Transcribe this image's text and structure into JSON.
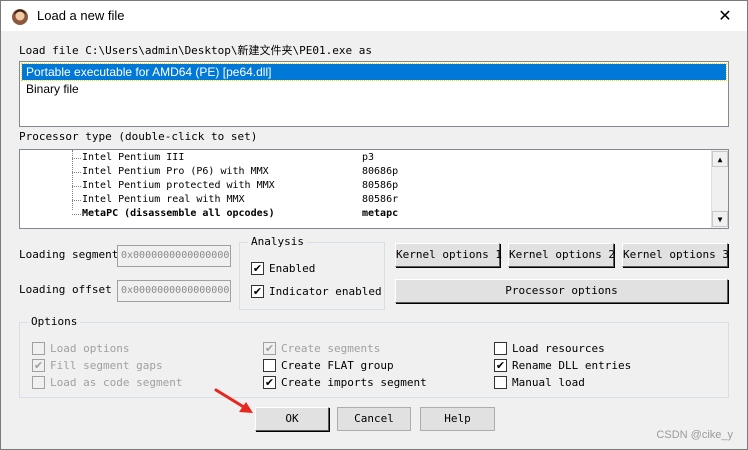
{
  "window": {
    "title": "Load a new file",
    "close_glyph": "✕",
    "icon": "app-avatar-icon"
  },
  "load_file": {
    "label": "Load file C:\\Users\\admin\\Desktop\\新建文件夹\\PE01.exe as",
    "formats": [
      {
        "label": "Portable executable for AMD64 (PE) [pe64.dll]",
        "selected": true
      },
      {
        "label": "Binary file",
        "selected": false
      }
    ]
  },
  "processor": {
    "label": "Processor type (double-click to set)",
    "items": [
      {
        "name": "Intel Pentium III",
        "code": "p3"
      },
      {
        "name": "Intel Pentium Pro (P6) with MMX",
        "code": "80686p"
      },
      {
        "name": "Intel Pentium protected with MMX",
        "code": "80586p"
      },
      {
        "name": "Intel Pentium real with MMX",
        "code": "80586r"
      },
      {
        "name": "MetaPC (disassemble all opcodes)",
        "code": "metapc",
        "bold": true
      }
    ],
    "scroll_up": "▲",
    "scroll_down": "▼"
  },
  "loading": {
    "segment_label": "Loading segment",
    "segment_value": "0x0000000000000000",
    "offset_label": "Loading offset",
    "offset_value": "0x0000000000000000"
  },
  "analysis": {
    "title": "Analysis",
    "enabled_label": "Enabled",
    "enabled_checked": true,
    "indicator_label": "Indicator enabled",
    "indicator_checked": true
  },
  "buttons": {
    "kernel1": "Kernel options 1",
    "kernel2": "Kernel options 2",
    "kernel3": "Kernel options 3",
    "processor_options": "Processor options",
    "ok": "OK",
    "cancel": "Cancel",
    "help": "Help"
  },
  "options": {
    "title": "Options",
    "col1": [
      {
        "label": "Load options",
        "checked": false,
        "disabled": true
      },
      {
        "label": "Fill segment gaps",
        "checked": true,
        "disabled": true
      },
      {
        "label": "Load as code segment",
        "checked": false,
        "disabled": true
      }
    ],
    "col2": [
      {
        "label": "Create segments",
        "checked": true,
        "disabled": true
      },
      {
        "label": "Create FLAT group",
        "checked": false,
        "disabled": false
      },
      {
        "label": "Create imports segment",
        "checked": true,
        "disabled": false
      }
    ],
    "col3": [
      {
        "label": "Load resources",
        "checked": false,
        "disabled": false
      },
      {
        "label": "Rename DLL entries",
        "checked": true,
        "disabled": false
      },
      {
        "label": "Manual load",
        "checked": false,
        "disabled": false
      }
    ]
  },
  "check_glyph": "✔",
  "watermark": "CSDN @cike_y",
  "colors": {
    "selection": "#0078d7",
    "arrow": "#e8251f"
  }
}
